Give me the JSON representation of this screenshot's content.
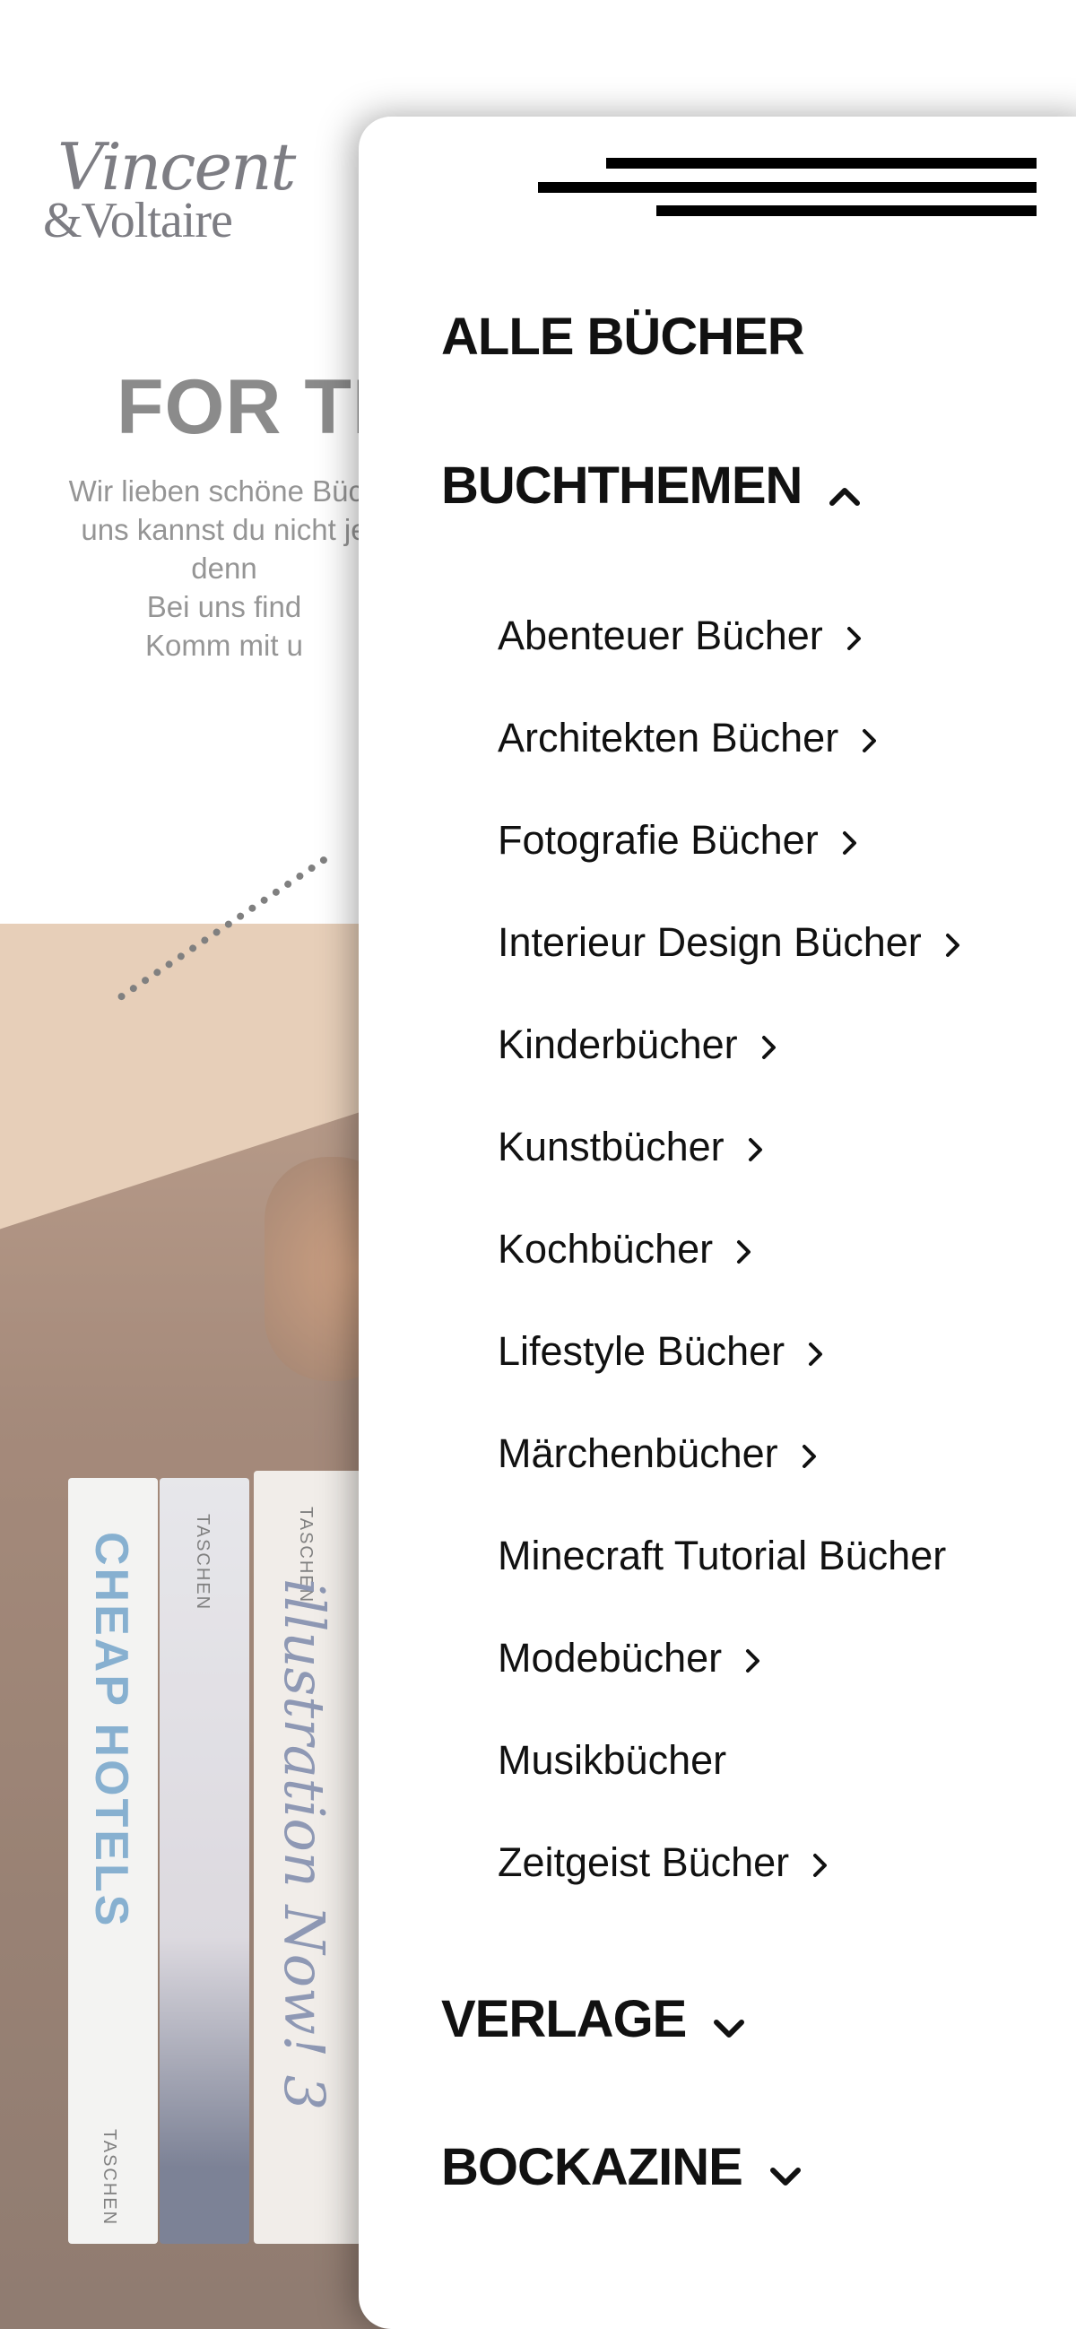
{
  "logo": {
    "line1": "Vincent",
    "line2": "&Voltaire"
  },
  "hero": {
    "title": "FOR TH",
    "intro": [
      "Wir lieben schöne Büch",
      "uns kannst du nicht je",
      "denn",
      "Bei uns find",
      "Komm mit u"
    ]
  },
  "photo": {
    "books": [
      {
        "spine": "CHEAP HOTELS",
        "small": "TASCHEN"
      },
      {
        "spine": "",
        "small": "TASCHEN"
      },
      {
        "spine": "illustration Now! 3",
        "small": "TASCHEN"
      }
    ]
  },
  "menu": {
    "toggle_icon": "hamburger-icon",
    "alle_buecher": "ALLE BÜCHER",
    "buchthemen": "BUCHTHEMEN",
    "buchthemen_items": [
      {
        "label": "Abenteuer Bücher",
        "arrow": true
      },
      {
        "label": "Architekten Bücher",
        "arrow": true
      },
      {
        "label": "Fotografie Bücher",
        "arrow": true
      },
      {
        "label": "Interieur Design Bücher",
        "arrow": true
      },
      {
        "label": "Kinderbücher",
        "arrow": true
      },
      {
        "label": "Kunstbücher",
        "arrow": true
      },
      {
        "label": "Kochbücher",
        "arrow": true
      },
      {
        "label": "Lifestyle Bücher",
        "arrow": true
      },
      {
        "label": "Märchenbücher",
        "arrow": true
      },
      {
        "label": "Minecraft Tutorial Bücher",
        "arrow": false
      },
      {
        "label": "Modebücher",
        "arrow": true
      },
      {
        "label": "Musikbücher",
        "arrow": false
      },
      {
        "label": "Zeitgeist Bücher",
        "arrow": true
      }
    ],
    "verlage": "VERLAGE",
    "bockazine": "BOCKAZINE"
  },
  "colors": {
    "drawer_bg": "#ffffff",
    "text": "#111111",
    "hero_title": "#444444"
  }
}
